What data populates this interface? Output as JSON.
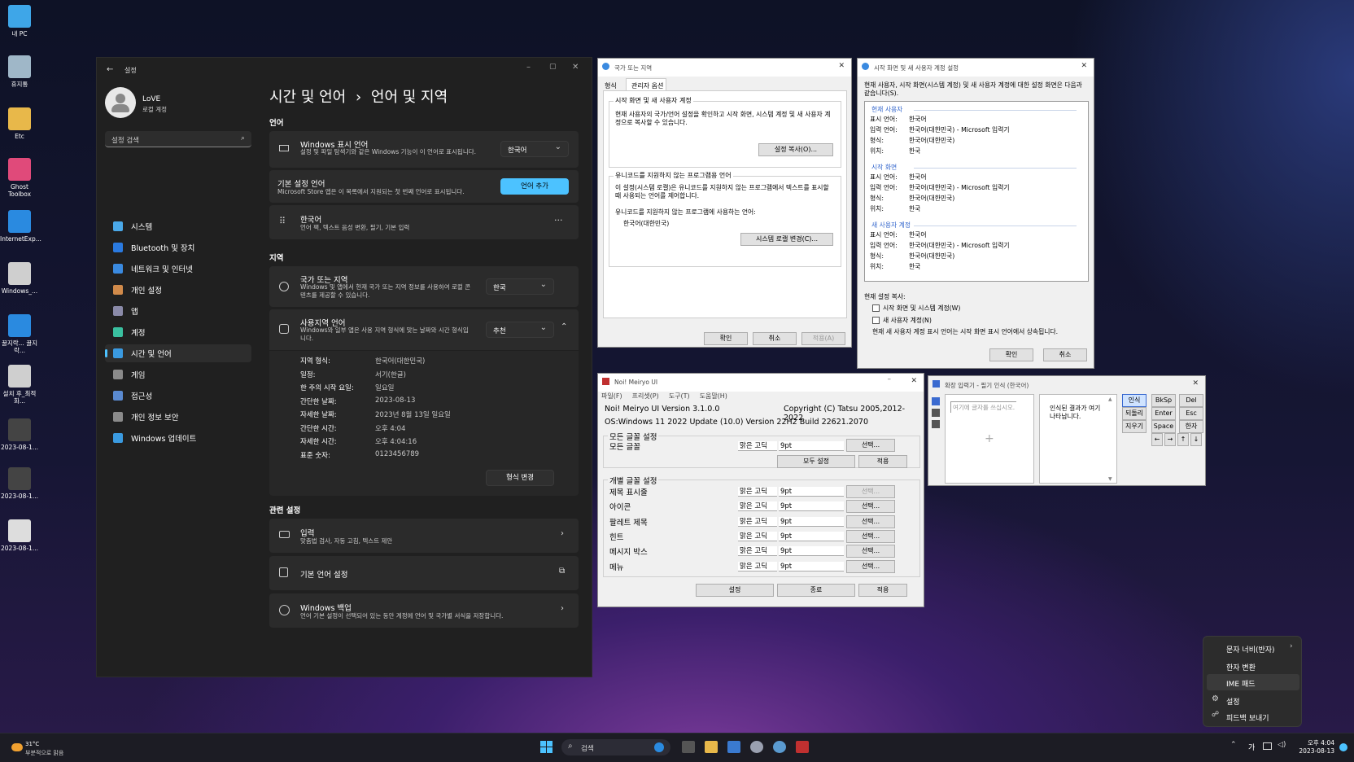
{
  "desktop": {
    "icons": [
      {
        "label": "내 PC",
        "name": "my-pc-icon",
        "color": "#3ea6e8"
      },
      {
        "label": "휴지통",
        "name": "recycle-bin-icon",
        "color": "#9fb7c8"
      },
      {
        "label": "Etc",
        "name": "folder-icon",
        "color": "#e8b84a"
      },
      {
        "label": "Ghost Toolbox",
        "name": "ghost-toolbox-icon",
        "color": "#e04a7a"
      },
      {
        "label": "InternetExp...",
        "name": "internet-explorer-icon",
        "color": "#2a8ae0"
      },
      {
        "label": "Windows_...",
        "name": "windows-settings-icon",
        "color": "#cfcfcf"
      },
      {
        "label": "꿀지락... 꿀지락...",
        "name": "ie-shortcut-icon",
        "color": "#2a8ae0"
      },
      {
        "label": "설치 후_최적화...",
        "name": "setup-icon",
        "color": "#cfcfcf"
      },
      {
        "label": "2023-08-1...",
        "name": "screenshot-1-icon",
        "color": "#444"
      },
      {
        "label": "2023-08-1...",
        "name": "screenshot-2-icon",
        "color": "#444"
      },
      {
        "label": "2023-08-1...",
        "name": "screenshot-3-icon",
        "color": "#ddd"
      }
    ]
  },
  "settings": {
    "app_title": "설정",
    "user": {
      "name": "LoVE",
      "type": "로컬 계정"
    },
    "search_placeholder": "설정 검색",
    "nav": [
      "시스템",
      "Bluetooth 및 장치",
      "네트워크 및 인터넷",
      "개인 설정",
      "앱",
      "계정",
      "시간 및 언어",
      "게임",
      "접근성",
      "개인 정보 보안",
      "Windows 업데이트"
    ],
    "nav_colors": [
      "#4aa8e8",
      "#2a7ae0",
      "#3a8ae0",
      "#d08a4a",
      "#8a8aa8",
      "#3ac0a0",
      "#3a9ae0",
      "#8a8a8a",
      "#5a8ad0",
      "#8a8a8a",
      "#3a9ae0"
    ],
    "breadcrumb_parent": "시간 및 언어",
    "breadcrumb_sep": "›",
    "breadcrumb_current": "언어 및 지역",
    "lang_section": "언어",
    "display_lang": {
      "title": "Windows 표시 언어",
      "desc": "설정 및 파일 탐색기와 같은 Windows 기능이 이 언어로 표시됩니다.",
      "value": "한국어"
    },
    "preferred": {
      "title": "기본 설정 언어",
      "desc": "Microsoft Store 앱은 이 목록에서 지원되는 첫 번째 언어로 표시됩니다.",
      "button": "언어 추가"
    },
    "korean": {
      "title": "한국어",
      "desc": "언어 팩, 텍스트 음성 변환, 필기, 기본 입력",
      "more": "···"
    },
    "region_section": "지역",
    "country": {
      "title": "국가 또는 지역",
      "desc": "Windows 및 앱에서 현재 국가 또는 지역 정보를 사용하여 로컬 콘텐츠를 제공할 수 있습니다.",
      "value": "한국"
    },
    "format": {
      "title": "사용지역 언어",
      "desc": "Windows와 일부 앱은 사용 지역 형식에 맞는 날짜와 시간 형식입니다.",
      "value": "추천"
    },
    "format_rows": [
      {
        "k": "지역 형식:",
        "v": "한국어(대한민국)"
      },
      {
        "k": "일정:",
        "v": "서기(한글)"
      },
      {
        "k": "한 주의 시작 요일:",
        "v": "일요일"
      },
      {
        "k": "간단한 날짜:",
        "v": "2023-08-13"
      },
      {
        "k": "자세한 날짜:",
        "v": "2023년 8월 13일 일요일"
      },
      {
        "k": "간단한 시간:",
        "v": "오후 4:04"
      },
      {
        "k": "자세한 시간:",
        "v": "오후 4:04:16"
      },
      {
        "k": "표준 숫자:",
        "v": "0123456789"
      }
    ],
    "format_button": "형식 변경",
    "related_section": "관련 설정",
    "input": {
      "title": "입력",
      "desc": "맞춤법 검사, 자동 고침, 텍스트 제안"
    },
    "admin_lang": {
      "title": "기본 언어 설정"
    },
    "backup": {
      "title": "Windows 백업",
      "desc": "언어 기본 설정이 선택되어 있는 동안 계정에 언어 및 국가별 서식을 저장합니다."
    }
  },
  "region_dialog": {
    "title": "국가 또는 지역",
    "tabs": [
      "형식",
      "관리자 옵션"
    ],
    "group1": {
      "label": "시작 화면 및 새 사용자 계정",
      "text": "현재 사용자의 국가/언어 설정을 확인하고 시작 화면, 시스템 계정 및 새 사용자 계정으로 복사할 수 있습니다.",
      "button": "설정 복사(O)..."
    },
    "group2": {
      "label": "유니코드를 지원하지 않는 프로그램용 언어",
      "text": "이 설정(시스템 로캘)은 유니코드를 지원하지 않는 프로그램에서 텍스트를 표시할 때 사용되는 언어를 제어합니다.",
      "text2": "유니코드를 지원하지 않는 프로그램에 사용하는 언어:",
      "value": "한국어(대한민국)",
      "button": "시스템 로캘 변경(C)..."
    },
    "buttons": [
      "확인",
      "취소",
      "적용(A)"
    ]
  },
  "welcome_dialog": {
    "title": "시작 화면 및 새 사용자 계정 설정",
    "intro": "현재 사용자, 시작 화면(시스템 계정) 및 새 사용자 계정에 대한 설정 화면은 다음과 같습니다(S).",
    "sections": [
      {
        "name": "현재 사용자",
        "rows": [
          [
            "표시 언어:",
            "한국어"
          ],
          [
            "입력 언어:",
            "한국어(대한민국) - Microsoft 입력기"
          ],
          [
            "형식:",
            "한국어(대한민국)"
          ],
          [
            "위치:",
            "한국"
          ]
        ]
      },
      {
        "name": "시작 화면",
        "rows": [
          [
            "표시 언어:",
            "한국어"
          ],
          [
            "입력 언어:",
            "한국어(대한민국) - Microsoft 입력기"
          ],
          [
            "형식:",
            "한국어(대한민국)"
          ],
          [
            "위치:",
            "한국"
          ]
        ]
      },
      {
        "name": "새 사용자 계정",
        "rows": [
          [
            "표시 언어:",
            "한국어"
          ],
          [
            "입력 언어:",
            "한국어(대한민국) - Microsoft 입력기"
          ],
          [
            "형식:",
            "한국어(대한민국)"
          ],
          [
            "위치:",
            "한국"
          ]
        ]
      }
    ],
    "copy_label": "현재 설정 복사:",
    "check1": "시작 화면 및 시스템 계정(W)",
    "check2": "새 사용자 계정(N)",
    "note": "현재 새 사용자 계정 표시 언어는 시작 화면 표시 언어에서 상속됩니다.",
    "buttons": [
      "확인",
      "취소"
    ]
  },
  "meiryo": {
    "title": "Noi! Meiryo UI",
    "menu": [
      "파일(F)",
      "프리셋(P)",
      "도구(T)",
      "도움말(H)"
    ],
    "version": "Noi! Meiryo UI Version 3.1.0.0",
    "copyright": "Copyright (C) Tatsu 2005,2012-2022",
    "os": "OS:Windows 11 2022 Update (10.0) Version 22H2 Build 22621.2070",
    "all_group": "모든 글꼴 설정",
    "all_label": "모든 글꼴",
    "all_font": "맑은 고딕",
    "all_size": "9pt",
    "select": "선택...",
    "all_setting": "모두 설정",
    "apply": "적용",
    "indiv_group": "개별 글꼴 설정",
    "rows": [
      {
        "label": "제목 표시줄",
        "font": "맑은 고딕",
        "size": "9pt"
      },
      {
        "label": "아이콘",
        "font": "맑은 고딕",
        "size": "9pt"
      },
      {
        "label": "팔레트 제목",
        "font": "맑은 고딕",
        "size": "9pt"
      },
      {
        "label": "힌트",
        "font": "맑은 고딕",
        "size": "9pt"
      },
      {
        "label": "메시지 박스",
        "font": "맑은 고딕",
        "size": "9pt"
      },
      {
        "label": "메뉴",
        "font": "맑은 고딕",
        "size": "9pt"
      }
    ],
    "bottom": [
      "설정",
      "종료",
      "적용"
    ]
  },
  "ime_pad": {
    "title": "확장 입력기 - 필기 인식 (한국어)",
    "write_hint": "여기에 글자를 쓰십시오.",
    "result_hint": "인식된 결과가 여기 나타납니다.",
    "buttons": [
      "인식",
      "되돌리기",
      "지우기"
    ],
    "keys": [
      "BkSp",
      "Del",
      "Enter",
      "Esc",
      "Space",
      "한자",
      "←",
      "→",
      "↑",
      "↓"
    ]
  },
  "ime_menu": {
    "items": [
      "문자 너비(반자)",
      "한자 변환",
      "IME 패드",
      "설정",
      "피드백 보내기"
    ]
  },
  "taskbar": {
    "weather_temp": "31°C",
    "weather_desc": "부분적으로 맑음",
    "search": "검색",
    "tray_lang": "가",
    "time": "오후 4:04",
    "date": "2023-08-13"
  }
}
